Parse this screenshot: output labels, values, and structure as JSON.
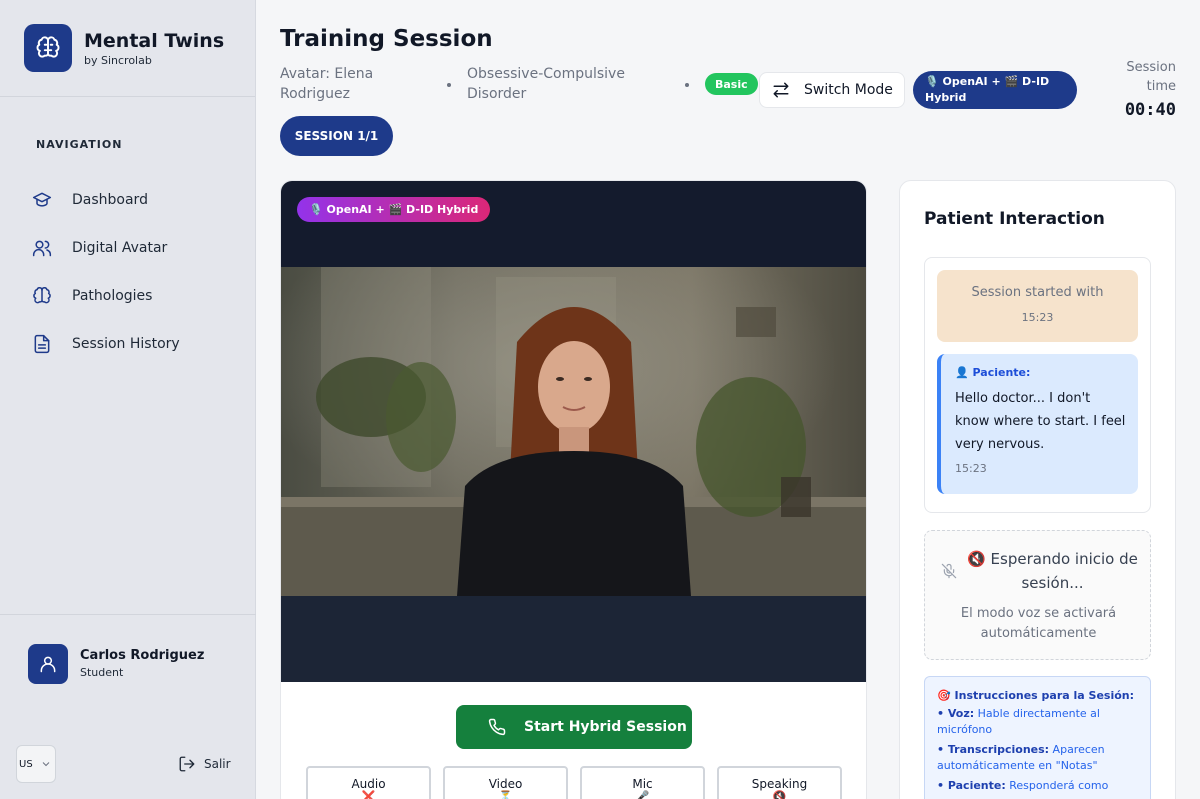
{
  "app": {
    "name": "Mental Twins",
    "subtitle": "by Sincrolab"
  },
  "sidebar": {
    "nav_heading": "NAVIGATION",
    "items": [
      {
        "label": "Dashboard",
        "icon": "graduation-cap-icon"
      },
      {
        "label": "Digital Avatar",
        "icon": "users-icon"
      },
      {
        "label": "Pathologies",
        "icon": "brain-icon"
      },
      {
        "label": "Session History",
        "icon": "document-icon"
      }
    ],
    "user": {
      "name": "Carlos Rodriguez",
      "role": "Student"
    },
    "language": "US",
    "logout_label": "Salir"
  },
  "header": {
    "title": "Training Session",
    "avatar_line1": "Avatar: Elena",
    "avatar_line2": "Rodriguez",
    "disorder_line1": "Obsessive-Compulsive",
    "disorder_line2": "Disorder",
    "badge": "Basic",
    "switch_label": "Switch Mode",
    "mode_line1": "🎙️ OpenAI + 🎬 D-ID",
    "mode_line2": "Hybrid",
    "session_time_label": "Session time",
    "session_time": "00:40",
    "session_counter": "SESSION 1/1"
  },
  "video": {
    "badge": "🎙️ OpenAI + 🎬 D-ID Hybrid",
    "start_label": "Start Hybrid Session",
    "tiles": [
      {
        "label": "Audio",
        "mark": "❌"
      },
      {
        "label": "Video",
        "mark": "⏳"
      },
      {
        "label": "Mic",
        "mark": "🎤"
      },
      {
        "label": "Speaking",
        "mark": "🔇"
      }
    ]
  },
  "interaction": {
    "title": "Patient Interaction",
    "system_message": "Session started with",
    "system_time": "15:23",
    "patient_label": "👤 Paciente:",
    "patient_message": "Hello doctor... I don't know where to start. I feel very nervous.",
    "patient_time": "15:23",
    "waiting_title": "🔇 Esperando inicio de sesión...",
    "waiting_sub": "El modo voz se activará automáticamente",
    "instructions_title": "🎯 Instrucciones para la Sesión:",
    "instructions": [
      {
        "bold": "• Voz:",
        "text": " Hable directamente al micrófono"
      },
      {
        "bold": "• Transcripciones:",
        "text": " Aparecen automáticamente en \"Notas\""
      },
      {
        "bold": "• Paciente:",
        "text": " Responderá como"
      }
    ]
  },
  "colors": {
    "primary": "#1e3a8a",
    "success": "#15803d",
    "badge_green": "#22c55e",
    "system_bubble": "#f6e3cc",
    "patient_bubble": "#dbeafe"
  }
}
